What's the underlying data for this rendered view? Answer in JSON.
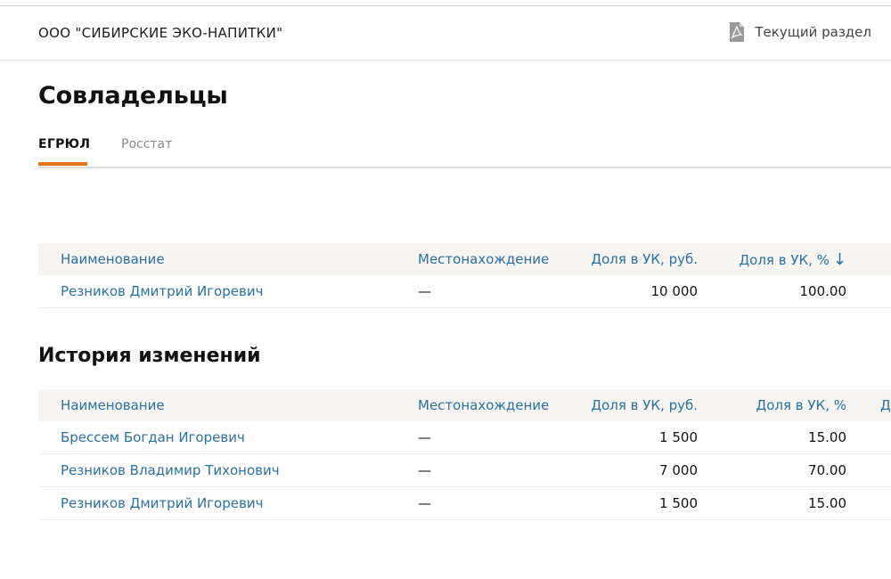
{
  "header": {
    "company_name": "ООО \"СИБИРСКИЕ ЭКО-НАПИТКИ\"",
    "current_section_label": "Текущий раздел"
  },
  "page": {
    "title": "Совладельцы",
    "tabs": [
      {
        "label": "ЕГРЮЛ",
        "active": true
      },
      {
        "label": "Росстат",
        "active": false
      }
    ]
  },
  "owners_table": {
    "columns": [
      "Наименование",
      "Местонахождение",
      "Доля в УК, руб.",
      "Доля в УК, %"
    ],
    "sort_indicator": "↓",
    "rows": [
      {
        "name": "Резников Дмитрий Игоревич",
        "location": "—",
        "share_rub": "10 000",
        "share_pct": "100.00"
      }
    ]
  },
  "history": {
    "title": "История изменений",
    "columns": [
      "Наименование",
      "Местонахождение",
      "Доля в УК, руб.",
      "Доля в УК, %"
    ],
    "overflow_column_fragment": "Д",
    "rows": [
      {
        "name": "Брессем Богдан Игоревич",
        "location": "—",
        "share_rub": "1 500",
        "share_pct": "15.00"
      },
      {
        "name": "Резников Владимир Тихонович",
        "location": "—",
        "share_rub": "7 000",
        "share_pct": "70.00"
      },
      {
        "name": "Резников Дмитрий Игоревич",
        "location": "—",
        "share_rub": "1 500",
        "share_pct": "15.00"
      }
    ]
  },
  "colors": {
    "link": "#2c6fa8",
    "accent": "#e8711c",
    "header_row_bg": "#f6f5f2"
  }
}
